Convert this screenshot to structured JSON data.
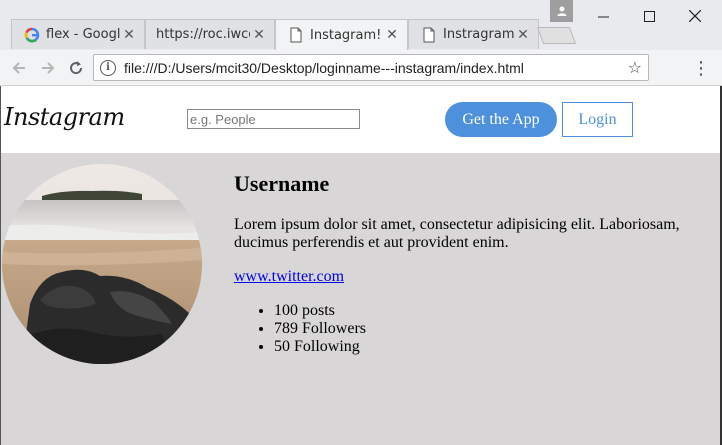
{
  "tabs": [
    {
      "title": "flex - Google",
      "icon": "google-icon",
      "active": false
    },
    {
      "title": "https://roc.iwcc.e",
      "icon": "",
      "active": false
    },
    {
      "title": "Instagram!",
      "icon": "page-icon",
      "active": true
    },
    {
      "title": "Instragram P",
      "icon": "page-icon",
      "active": false
    }
  ],
  "address": {
    "url": "file:///D:/Users/mcit30/Desktop/loginname---instagram/index.html"
  },
  "site": {
    "logo": "Instagram",
    "search_placeholder": "e.g. People",
    "get_app_label": "Get the App",
    "login_label": "Login"
  },
  "profile": {
    "username": "Username",
    "bio": "Lorem ipsum dolor sit amet, consectetur adipisicing elit. Laboriosam, ducimus perferendis et aut provident enim.",
    "link": "www.twitter.com",
    "stats": [
      "100 posts",
      "789 Followers",
      "50 Following"
    ]
  },
  "colors": {
    "accent": "#4d90dc",
    "page_bg": "#d8d6d6"
  }
}
